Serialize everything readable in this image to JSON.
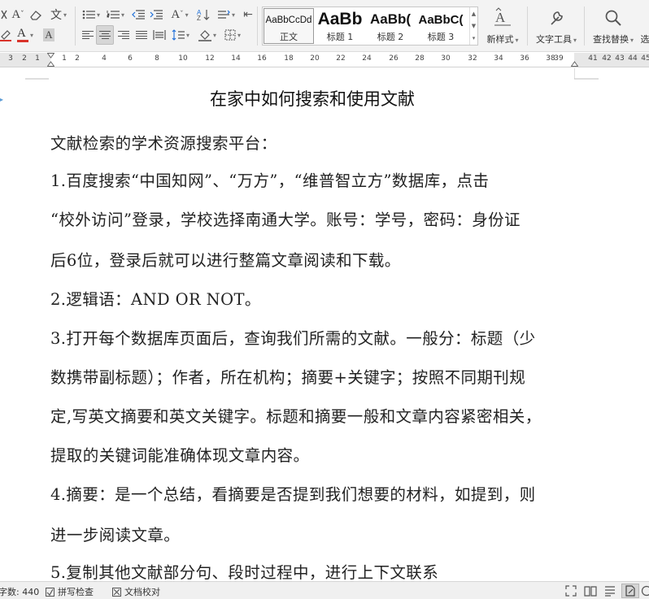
{
  "toolbar": {
    "font_size_down": "A",
    "strikethrough": "文",
    "underline_a": "A",
    "clear_format": "A",
    "text_effect": "A",
    "sort": "A",
    "styles": [
      {
        "preview": "AaBbCcDd",
        "name": "正文",
        "selected": true
      },
      {
        "preview": "AaBb",
        "name": "标题 1",
        "selected": false
      },
      {
        "preview": "AaBb(",
        "name": "标题 2",
        "selected": false
      },
      {
        "preview": "AaBbC(",
        "name": "标题 3",
        "selected": false
      }
    ],
    "new_style_glyph": "A",
    "new_style_label": "新样式",
    "text_tools_label": "文字工具",
    "find_replace_label": "查找替换",
    "select_label": "选"
  },
  "ruler": {
    "left_numbers": [
      "3",
      "2",
      "1"
    ],
    "numbers": [
      "1",
      "2",
      "4",
      "6",
      "8",
      "10",
      "12",
      "14",
      "16",
      "18",
      "20",
      "22",
      "24",
      "26",
      "28",
      "30",
      "32",
      "34",
      "36",
      "38",
      "39"
    ],
    "right_numbers": [
      "41",
      "42",
      "43",
      "44",
      "45"
    ]
  },
  "document": {
    "title": "在家中如何搜索和使用文献",
    "paragraphs": [
      "文献检索的学术资源搜索平台：",
      "1.百度搜索“中国知网”、“万方”，“维普智立方”数据库，点击",
      "“校外访问”登录，学校选择南通大学。账号：学号，密码：身份证",
      "后6位，登录后就可以进行整篇文章阅读和下载。",
      "2.逻辑语：AND OR NOT。",
      "3.打开每个数据库页面后，查询我们所需的文献。一般分：标题（少",
      "数携带副标题）；作者，所在机构；摘要+关键字；按照不同期刊规",
      "定,写英文摘要和英文关键字。标题和摘要一般和文章内容紧密相关，",
      "提取的关键词能准确体现文章内容。",
      "4.摘要：是一个总结，看摘要是否提到我们想要的材料，如提到，则",
      "进一步阅读文章。",
      "5.复制其他文献部分句、段时过程中，进行上下文联系"
    ]
  },
  "statusbar": {
    "word_count": "字数: 440",
    "spell_check": "拼写检查",
    "doc_proofread": "文档校对"
  },
  "colors": {
    "accent_red": "#d9342b",
    "accent_blue": "#1e6fd9",
    "paragraph_marker": "#5b9bd5"
  }
}
